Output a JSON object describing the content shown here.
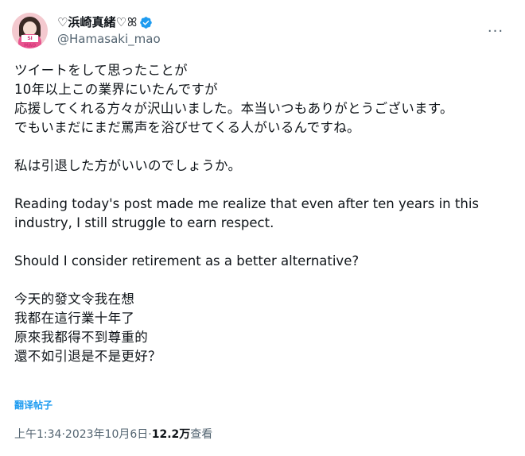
{
  "author": {
    "display_name": "♡浜崎真緒♡",
    "name_suffix_glyph": "ꕤ",
    "handle": "@Hamasaki_mao",
    "avatar_tag": "SI MAO",
    "verified": true,
    "verified_color": "#1d9bf0"
  },
  "more_label": "···",
  "tweet": {
    "ja_lines": [
      "ツイートをして思ったことが",
      "10年以上この業界にいたんですが",
      "応援してくれる方々が沢山いました。本当いつもありがとうございます。",
      "でもいまだにまだ罵声を浴びせてくる人がいるんですね。"
    ],
    "ja_question": "私は引退した方がいいのでしょうか。",
    "en_lines": [
      "Reading today's post made me realize that even after ten years in this",
      "industry, I still struggle to earn respect."
    ],
    "en_question": "Should I consider retirement as a better alternative?",
    "zh_lines": [
      "今天的發文令我在想",
      "我都在這行業十年了",
      "原來我都得不到尊重的",
      "還不如引退是不是更好？"
    ]
  },
  "translate_label": "翻译帖子",
  "meta": {
    "time": "上午1:34",
    "sep1": " · ",
    "date": "2023年10月6日",
    "sep2": " · ",
    "views_count": "12.2万",
    "views_label": " 查看"
  },
  "colors": {
    "link": "#1d9bf0",
    "secondary_text": "#536471",
    "primary_text": "#0f1419"
  }
}
